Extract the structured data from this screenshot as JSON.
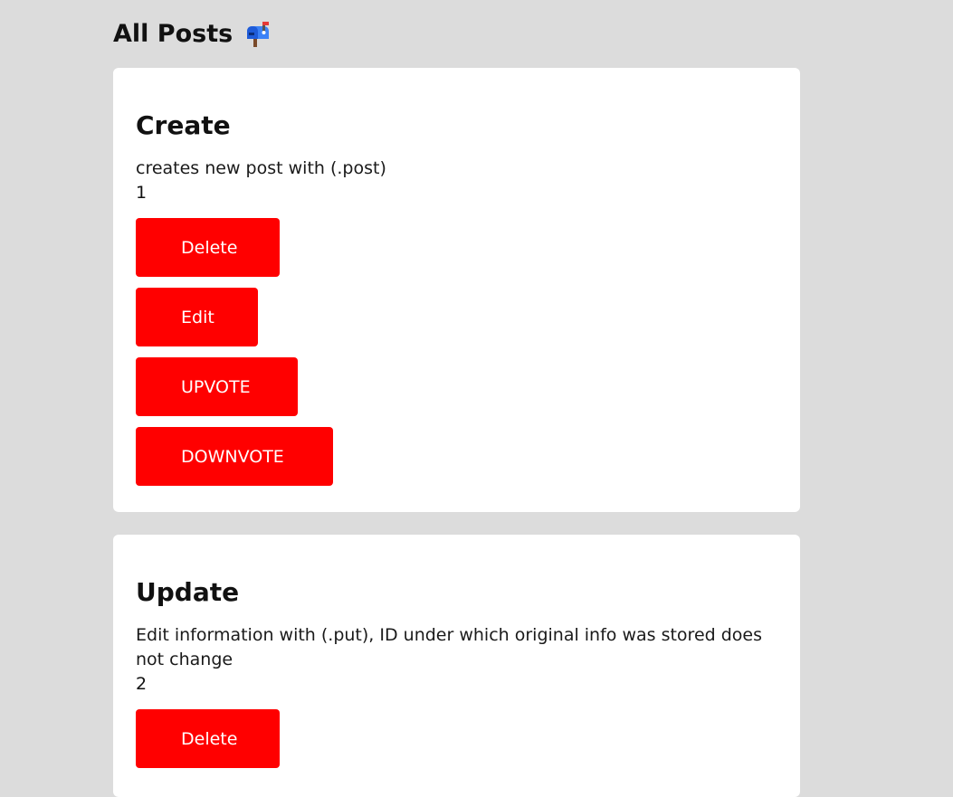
{
  "page": {
    "title": "All Posts",
    "title_icon": "mailbox-icon"
  },
  "colors": {
    "background": "#dcdcdc",
    "card": "#ffffff",
    "button": "#ff0000",
    "button_text": "#ffffff"
  },
  "posts": [
    {
      "title": "Create",
      "description": "creates new post with (.post)",
      "id": "1",
      "buttons": {
        "delete": "Delete",
        "edit": "Edit",
        "upvote": "UPVOTE",
        "downvote": "DOWNVOTE"
      }
    },
    {
      "title": "Update",
      "description": "Edit information with (.put), ID under which original info was stored does not change",
      "id": "2",
      "buttons": {
        "delete": "Delete"
      }
    }
  ]
}
